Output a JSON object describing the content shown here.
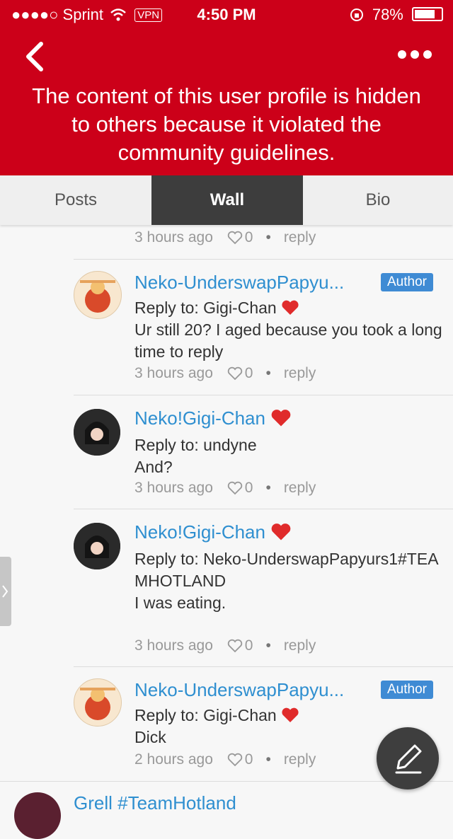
{
  "status_bar": {
    "carrier": "●●●●○ Sprint",
    "vpn": "VPN",
    "time": "4:50 PM",
    "battery": "78%"
  },
  "banner": {
    "message": "The content of this user profile is hidden to others because it violated the community guidelines."
  },
  "tabs": [
    {
      "label": "Posts"
    },
    {
      "label": "Wall"
    },
    {
      "label": "Bio"
    }
  ],
  "comments": [
    {
      "name": "",
      "time": "3 hours ago",
      "likes": "0",
      "reply": "reply"
    },
    {
      "name": "Neko-UnderswapPapyu...",
      "badge": "Author",
      "reply_to": "Reply to: Gigi-Chan",
      "text": "Ur still 20? I aged because you took a long time to reply",
      "time": "3 hours ago",
      "likes": "0",
      "reply": "reply"
    },
    {
      "name": "Neko!Gigi-Chan",
      "reply_to": "Reply to: undyne",
      "text": "And?",
      "time": "3 hours ago",
      "likes": "0",
      "reply": "reply"
    },
    {
      "name": "Neko!Gigi-Chan",
      "reply_to": "Reply to: Neko-UnderswapPapyurs1#TEAMHOTLAND",
      "text": "I was eating.",
      "time": "3 hours ago",
      "likes": "0",
      "reply": "reply"
    },
    {
      "name": "Neko-UnderswapPapyu...",
      "badge": "Author",
      "reply_to": "Reply to: Gigi-Chan",
      "text": "Dick",
      "time": "2 hours ago",
      "likes": "0",
      "reply": "reply"
    },
    {
      "name": "Grell #TeamHotland"
    }
  ],
  "colors": {
    "banner": "#cc0019",
    "link": "#2f8fd0",
    "badge": "#3f8bd4",
    "active_tab": "#3d3d3d"
  },
  "icons": [
    "back-chevron-icon",
    "more-icon",
    "heart-icon",
    "edit-pencil-icon",
    "red-heart-emoji-icon"
  ]
}
